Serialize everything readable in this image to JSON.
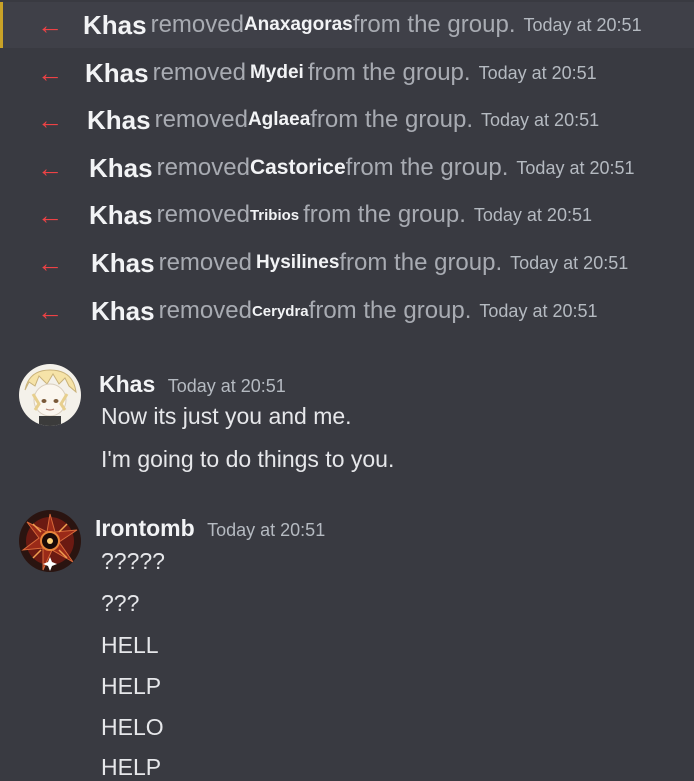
{
  "system_messages": [
    {
      "actor": "Khas",
      "verb": "removed",
      "target": "Anaxagoras",
      "rest": "from the group.",
      "timestamp": "Today at 20:51"
    },
    {
      "actor": "Khas",
      "verb": "removed",
      "target": "Mydei",
      "rest": "from the group.",
      "timestamp": "Today at 20:51"
    },
    {
      "actor": "Khas",
      "verb": "removed",
      "target": "Aglaea",
      "rest": "from the group.",
      "timestamp": "Today at 20:51"
    },
    {
      "actor": "Khas",
      "verb": "removed",
      "target": "Castorice",
      "rest": "from the group.",
      "timestamp": "Today at 20:51"
    },
    {
      "actor": "Khas",
      "verb": "removed",
      "target": "Tribios",
      "rest": "from the group.",
      "timestamp": "Today at 20:51"
    },
    {
      "actor": "Khas",
      "verb": "removed",
      "target": "Hysilines",
      "rest": "from the group.",
      "timestamp": "Today at 20:51"
    },
    {
      "actor": "Khas",
      "verb": "removed",
      "target": "Cerydra",
      "rest": "from the group.",
      "timestamp": "Today at 20:51"
    }
  ],
  "messages": [
    {
      "author": "Khas",
      "timestamp": "Today at 20:51",
      "lines": [
        "Now its just you and me.",
        "I'm going to do things to you."
      ]
    },
    {
      "author": "Irontomb",
      "timestamp": "Today at 20:51",
      "lines": [
        "?????",
        "???",
        "HELL",
        "HELP",
        "HELO",
        "HELP"
      ]
    }
  ],
  "icons": {
    "system_arrow": "arrow-left-icon",
    "arrow_color": "#ed4245"
  }
}
